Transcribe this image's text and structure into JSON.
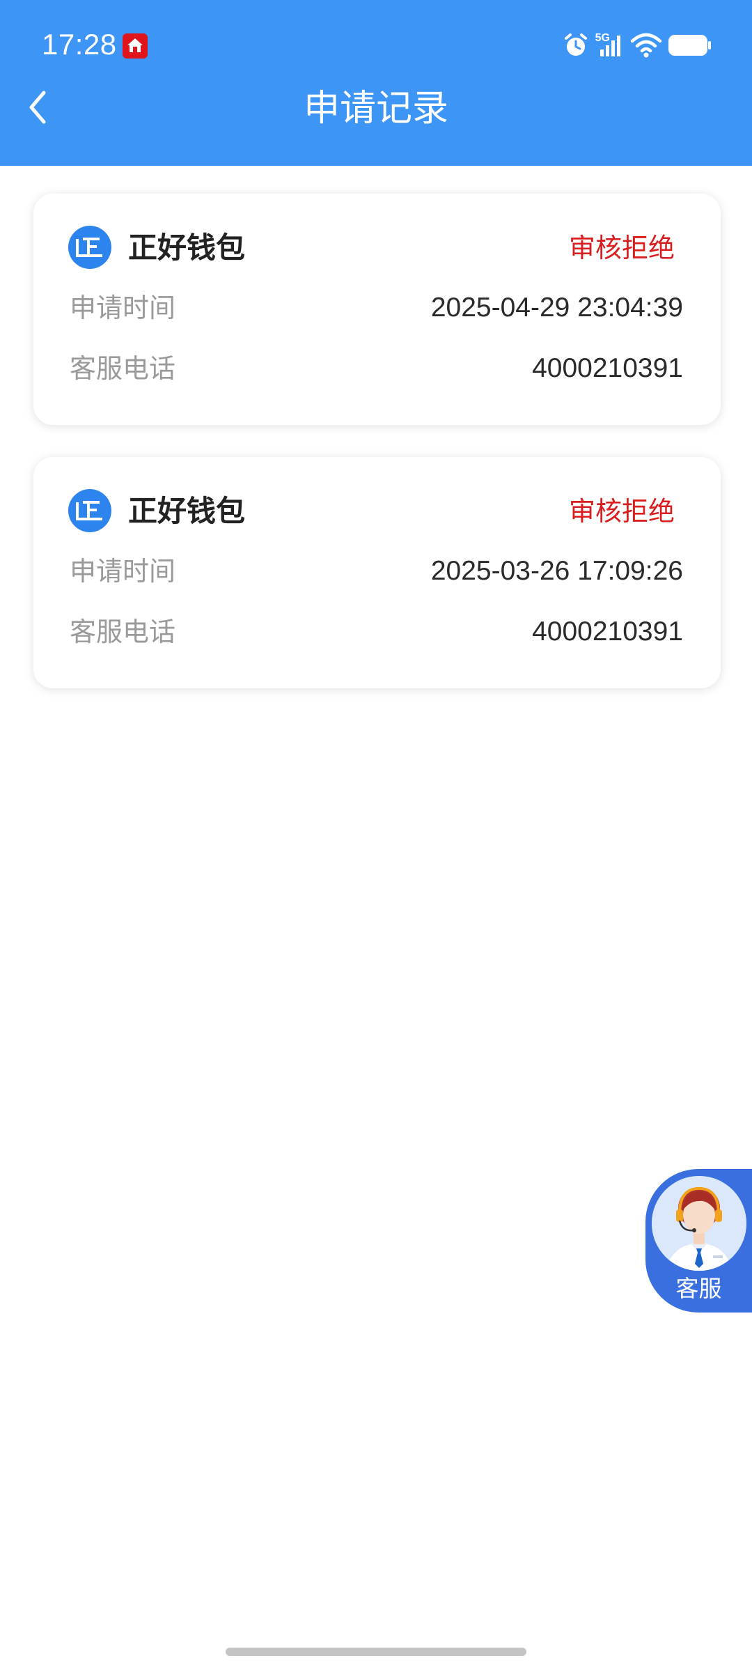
{
  "status_bar": {
    "time": "17:28",
    "network": "5G",
    "notification_icon": "home-app-icon",
    "icons": [
      "alarm-icon",
      "signal-icon",
      "wifi-icon",
      "battery-icon"
    ]
  },
  "header": {
    "title": "申请记录",
    "back_icon": "chevron-left-icon",
    "background_color": "#3d95f6"
  },
  "records": [
    {
      "app_name": "正好钱包",
      "status": "审核拒绝",
      "apply_time_label": "申请时间",
      "apply_time": "2025-04-29 23:04:39",
      "phone_label": "客服电话",
      "phone": "4000210391"
    },
    {
      "app_name": "正好钱包",
      "status": "审核拒绝",
      "apply_time_label": "申请时间",
      "apply_time": "2025-03-26 17:09:26",
      "phone_label": "客服电话",
      "phone": "4000210391"
    }
  ],
  "customer_service": {
    "label": "客服",
    "icon": "customer-service-agent-icon"
  },
  "colors": {
    "status_rejected": "#d81e1e",
    "accent": "#3d95f6",
    "cs_button": "#3a63df"
  }
}
